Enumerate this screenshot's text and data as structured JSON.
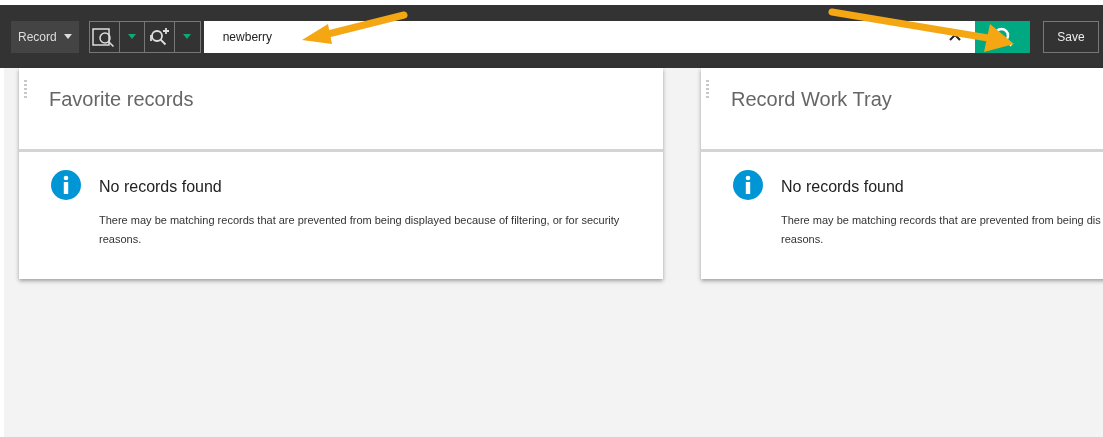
{
  "toolbar": {
    "scope_label": "Record",
    "search": {
      "value": "newberry"
    },
    "save_label": "Save"
  },
  "panels": [
    {
      "title": "Favorite records",
      "message_title": "No records found",
      "message_body": "There may be matching records that are prevented from being displayed because of filtering, or for security reasons."
    },
    {
      "title": "Record Work Tray",
      "message_title": "No records found",
      "message_body": "There may be matching records that are prevented from being dis",
      "line_2": "reasons."
    }
  ]
}
